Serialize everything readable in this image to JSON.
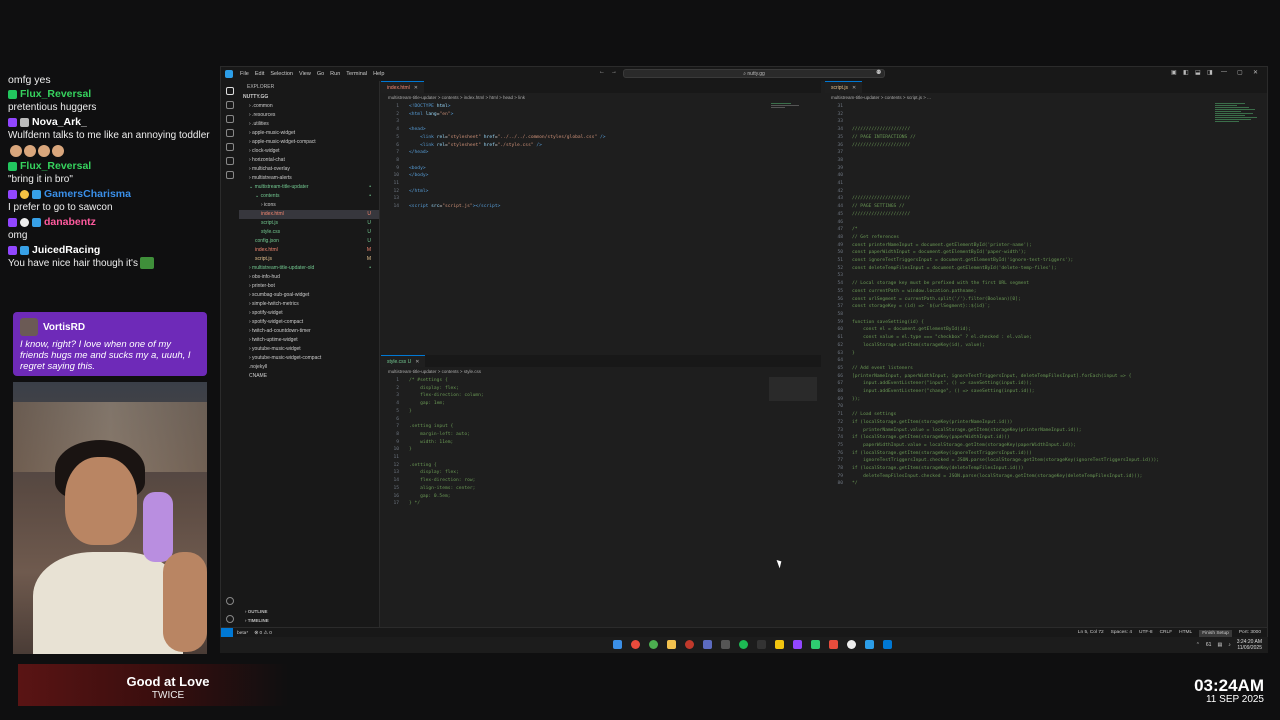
{
  "chat": {
    "first_line": "omfg yes",
    "messages": [
      {
        "user": "Flux_Reversal",
        "color": "#36d35e",
        "text": "pretentious huggers"
      },
      {
        "user": "Nova_Ark_",
        "color": "#ffffff",
        "text": "Wulfdenn talks to me like an annoying toddler"
      },
      {
        "user": "Flux_Reversal",
        "color": "#36d35e",
        "text": "\"bring it in bro\""
      },
      {
        "user": "GamersCharisma",
        "color": "#3a8fe8",
        "text": "I prefer to go to sawcon"
      },
      {
        "user": "danabentz",
        "color": "#ff5a9e",
        "text": "omg"
      },
      {
        "user": "JuicedRacing",
        "color": "#ffffff",
        "text": "You have nice hair though it's"
      }
    ],
    "highlight": {
      "user": "VortisRD",
      "text": "I know, right? I love when one of my friends hugs me and sucks my a, uuuh, I regret saying this."
    }
  },
  "now_playing": {
    "title": "Good at Love",
    "artist": "TWICE"
  },
  "clock": {
    "time": "03:24AM",
    "date": "11 SEP 2025"
  },
  "vscode": {
    "menu": [
      "File",
      "Edit",
      "Selection",
      "View",
      "Go",
      "Run",
      "Terminal",
      "Help"
    ],
    "search_placeholder": "nutty.gg",
    "explorer": {
      "header": "EXPLORER",
      "root": "NUTTY.GG",
      "items": [
        {
          "label": "› .common",
          "indent": 1,
          "status": ""
        },
        {
          "label": "› .resources",
          "indent": 1,
          "status": ""
        },
        {
          "label": "› .utilities",
          "indent": 1,
          "status": ""
        },
        {
          "label": "› apple-music-widget",
          "indent": 1,
          "status": ""
        },
        {
          "label": "› apple-music-widget-compact",
          "indent": 1,
          "status": ""
        },
        {
          "label": "› clock-widget",
          "indent": 1,
          "status": ""
        },
        {
          "label": "› horizontal-chat",
          "indent": 1,
          "status": ""
        },
        {
          "label": "› multichat-overlay",
          "indent": 1,
          "status": ""
        },
        {
          "label": "› multistream-alerts",
          "indent": 1,
          "status": ""
        },
        {
          "label": "⌄ multistream-title-updater",
          "indent": 1,
          "status": "•",
          "color": "#73c991"
        },
        {
          "label": "⌄ contents",
          "indent": 2,
          "status": "•",
          "color": "#73c991"
        },
        {
          "label": "› icons",
          "indent": 3,
          "status": ""
        },
        {
          "label": "index.html",
          "indent": 3,
          "status": "U",
          "color": "#f48771",
          "selected": true
        },
        {
          "label": "script.js",
          "indent": 3,
          "status": "U",
          "color": "#73c991"
        },
        {
          "label": "style.css",
          "indent": 3,
          "status": "U",
          "color": "#73c991"
        },
        {
          "label": "config.json",
          "indent": 2,
          "status": "U",
          "color": "#73c991"
        },
        {
          "label": "index.html",
          "indent": 2,
          "status": "M",
          "color": "#f48771"
        },
        {
          "label": "script.js",
          "indent": 2,
          "status": "M",
          "color": "#e2c08d"
        },
        {
          "label": "› multistream-title-updater-old",
          "indent": 1,
          "status": "•",
          "color": "#73c991"
        },
        {
          "label": "› obs-info-hud",
          "indent": 1,
          "status": ""
        },
        {
          "label": "› printer-bot",
          "indent": 1,
          "status": ""
        },
        {
          "label": "› scumbag-sub-goal-widget",
          "indent": 1,
          "status": ""
        },
        {
          "label": "› simple-twitch-metrics",
          "indent": 1,
          "status": ""
        },
        {
          "label": "› spotify-widget",
          "indent": 1,
          "status": ""
        },
        {
          "label": "› spotify-widget-compact",
          "indent": 1,
          "status": ""
        },
        {
          "label": "› twitch-ad-countdown-timer",
          "indent": 1,
          "status": ""
        },
        {
          "label": "› twitch-uptime-widget",
          "indent": 1,
          "status": ""
        },
        {
          "label": "› youtube-music-widget",
          "indent": 1,
          "status": ""
        },
        {
          "label": "› youtube-music-widget-compact",
          "indent": 1,
          "status": ""
        },
        {
          "label": ".nojekyll",
          "indent": 1,
          "status": ""
        },
        {
          "label": "CNAME",
          "indent": 1,
          "status": ""
        }
      ],
      "outline": "OUTLINE",
      "timeline": "TIMELINE"
    },
    "left_top": {
      "tab": "index.html",
      "crumbs": "multistream-title-updater > contents > index.html > html > head > link",
      "lines": [
        "1",
        "2",
        "3",
        "4",
        "5",
        "6",
        "7",
        "8",
        "9",
        "10",
        "11",
        "12",
        "13",
        "14"
      ]
    },
    "left_bottom": {
      "tab": "style.css",
      "tab_status": "U",
      "crumbs": "multistream-title-updater > contents > style.css",
      "lines": [
        "1",
        "2",
        "3",
        "4",
        "5",
        "6",
        "7",
        "8",
        "9",
        "10",
        "11",
        "12",
        "13",
        "14",
        "15",
        "16",
        "17"
      ]
    },
    "right": {
      "tab": "script.js",
      "crumbs": "multistream-title-updater > contents > script.js > ...",
      "lines": [
        "31",
        "32",
        "33",
        "34",
        "35",
        "36",
        "37",
        "38",
        "39",
        "40",
        "41",
        "42",
        "43",
        "44",
        "45",
        "46",
        "47",
        "48",
        "49",
        "50",
        "51",
        "52",
        "53",
        "54",
        "55",
        "56",
        "57",
        "58",
        "59",
        "60",
        "61",
        "62",
        "63",
        "64",
        "65",
        "66",
        "67",
        "68",
        "69",
        "70",
        "71",
        "72",
        "73",
        "74",
        "75",
        "76",
        "77",
        "78",
        "79",
        "80"
      ]
    },
    "status": {
      "branch": "beta*",
      "problems": "⊗ 0 ⚠ 0",
      "position": "Ln 5, Col 72",
      "spaces": "Spaces: 4",
      "encoding": "UTF-8",
      "eol": "CRLF",
      "language": "HTML",
      "setup": "Finish Setup",
      "port": "Port: 3000"
    }
  },
  "taskbar": {
    "temp": "61",
    "time": "3:24:20 AM",
    "date": "11/09/2025"
  }
}
